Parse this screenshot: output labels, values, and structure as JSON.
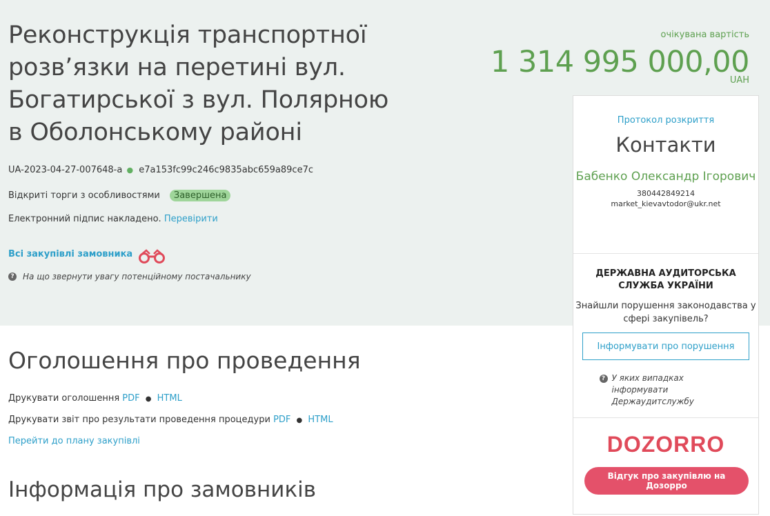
{
  "tender": {
    "title": "Реконструкція транспортної розв’язки на перетині вул. Богатирської з вул. Полярною в Оболонському районі",
    "id": "UA-2023-04-27-007648-a",
    "hash": "e7a153fc99c246c9835abc659a89ce7c",
    "procedure": "Відкриті торги з особливостями",
    "status": "Завершена",
    "signature_text": "Електронний підпис накладено.",
    "verify_link": "Перевірити",
    "all_purchases_link": "Всі закупівлі замовника",
    "supplier_hint": "На що звернути увагу потенційному постачальнику"
  },
  "cost": {
    "label": "очікувана вартість",
    "value": "1 314 995 000,00",
    "currency": "UAH"
  },
  "sidebar": {
    "protocol_link": "Протокол розкриття",
    "contacts_title": "Контакти",
    "contact_name": "Бабенко Олександр Ігорович",
    "contact_phone": "380442849214",
    "contact_email": "market_kievavtodor@ukr.net",
    "audit_title": "ДЕРЖАВНА АУДИТОРСЬКА СЛУЖБА УКРАЇНИ",
    "audit_question": "Знайшли порушення законодавства у сфері закупівель?",
    "report_button": "Інформувати про порушення",
    "audit_hint": "У яких випадках інформувати Держаудитслужбу",
    "dozorro_logo": "DOZORRO",
    "dozorro_button": "Відгук про закупівлю на Дозорро"
  },
  "announcement": {
    "title": "Оголошення про проведення",
    "print_notice_label": "Друкувати оголошення",
    "print_report_label": "Друкувати звіт про результати проведення процедури",
    "pdf": "PDF",
    "html": "HTML",
    "sep": "●",
    "plan_link": "Перейти до плану закупівлі"
  },
  "customers": {
    "title": "Інформація про замовників"
  },
  "icons": {
    "binoculars": "binoculars-icon",
    "question": "question-circle-icon",
    "hint_glyph": "?"
  },
  "colors": {
    "green": "#5ea050",
    "link": "#2d9fc9",
    "dozorro": "#e4516a",
    "band": "#ecf1ef"
  }
}
